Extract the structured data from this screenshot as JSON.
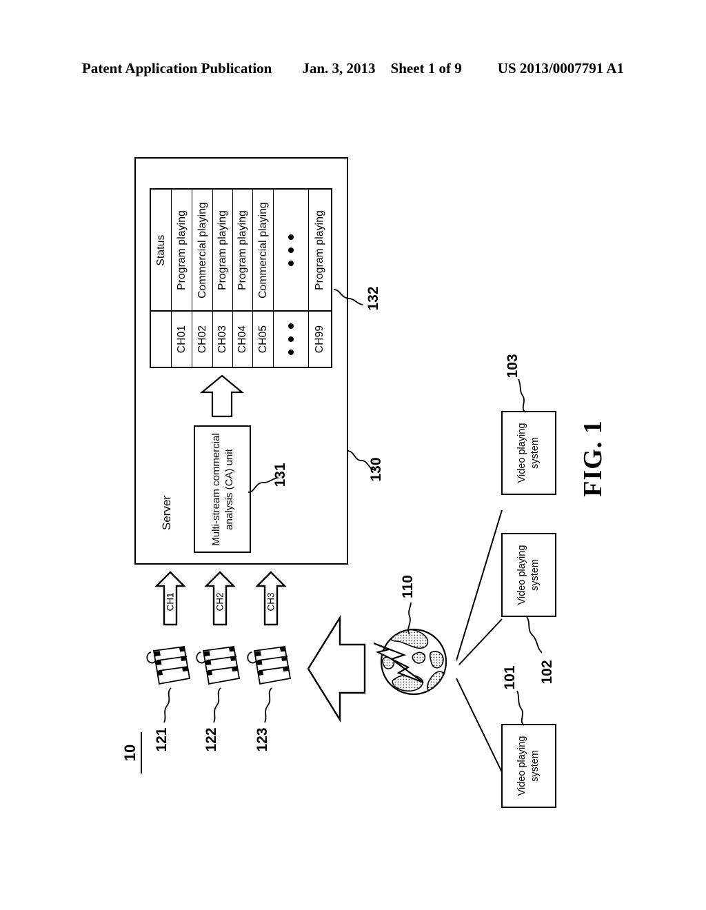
{
  "header": {
    "publication": "Patent Application Publication",
    "date": "Jan. 3, 2013",
    "sheet": "Sheet 1 of 9",
    "patent_number": "US 2013/0007791 A1"
  },
  "figure": {
    "label": "FIG. 1",
    "system_id": "10"
  },
  "server": {
    "title": "Server",
    "ref": "130",
    "ca_unit": {
      "label": "Multi-stream commercial analysis (CA) unit",
      "ref": "131"
    },
    "status_table": {
      "ref": "132",
      "header": "Status",
      "rows": [
        {
          "channel": "CH01",
          "status": "Program playing"
        },
        {
          "channel": "CH02",
          "status": "Commercial playing"
        },
        {
          "channel": "CH03",
          "status": "Program playing"
        },
        {
          "channel": "CH04",
          "status": "Program playing"
        },
        {
          "channel": "CH05",
          "status": "Commercial playing"
        },
        {
          "channel": "• • •",
          "status": "• • •"
        },
        {
          "channel": "CH99",
          "status": "Program playing"
        }
      ]
    }
  },
  "streams": [
    {
      "ref": "121",
      "channel": "CH1"
    },
    {
      "ref": "122",
      "channel": "CH2"
    },
    {
      "ref": "123",
      "channel": "CH3"
    }
  ],
  "network": {
    "ref": "110",
    "icon": "globe-lightning-icon"
  },
  "clients": [
    {
      "label": "Video playing system",
      "ref": "101"
    },
    {
      "label": "Video playing system",
      "ref": "102"
    },
    {
      "label": "Video playing system",
      "ref": "103"
    }
  ],
  "colors": {
    "ink": "#000000",
    "paper": "#ffffff",
    "fill_dot": "#bfbfbf"
  }
}
